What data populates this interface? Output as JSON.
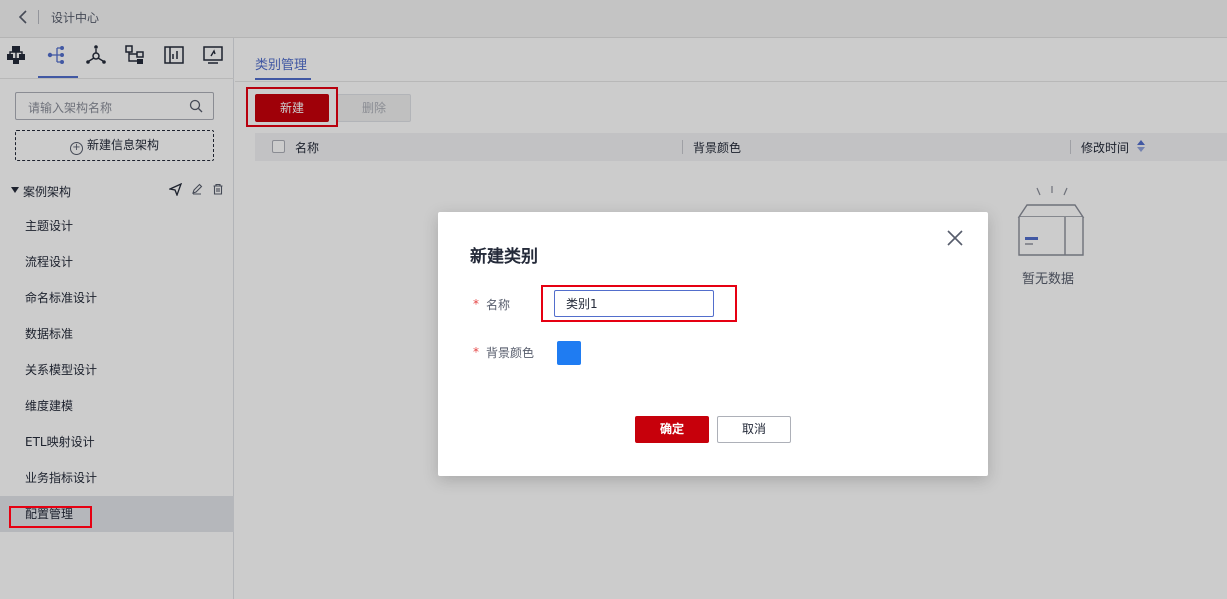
{
  "topbar": {
    "back_icon": "chevron-left-icon",
    "title": "设计中心"
  },
  "sidebar": {
    "icons": [
      {
        "name": "architecture-icon",
        "active": false
      },
      {
        "name": "tree-structure-icon",
        "active": true
      },
      {
        "name": "hub-network-icon",
        "active": false
      },
      {
        "name": "flow-chart-icon",
        "active": false
      },
      {
        "name": "parallel-bars-icon",
        "active": false
      },
      {
        "name": "monitor-icon",
        "active": false
      }
    ],
    "search_placeholder": "请输入架构名称",
    "new_arch_label": "新建信息架构",
    "tree_root_label": "案例架构",
    "items": [
      {
        "label": "主题设计"
      },
      {
        "label": "流程设计"
      },
      {
        "label": "命名标准设计"
      },
      {
        "label": "数据标准"
      },
      {
        "label": "关系模型设计"
      },
      {
        "label": "维度建模"
      },
      {
        "label": "ETL映射设计"
      },
      {
        "label": "业务指标设计"
      },
      {
        "label": "配置管理",
        "selected": true
      }
    ]
  },
  "main": {
    "tab_label": "类别管理",
    "new_button": "新建",
    "delete_button": "删除",
    "columns": [
      "名称",
      "背景颜色",
      "修改时间"
    ],
    "empty_text": "暂无数据"
  },
  "dialog": {
    "title": "新建类别",
    "name_label": "名称",
    "name_value": "类别1",
    "color_label": "背景颜色",
    "color_value": "#1f7cf2",
    "confirm_button": "确定",
    "cancel_button": "取消",
    "required_mark": "*"
  },
  "colors": {
    "brand_red": "#c7000b",
    "highlight": "#e60012",
    "accent_blue": "#526ecc"
  }
}
